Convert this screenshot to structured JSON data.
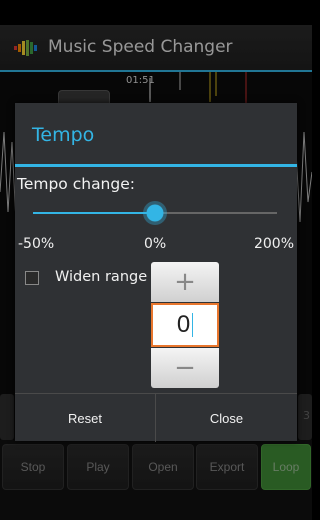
{
  "app": {
    "title": "Music Speed Changer"
  },
  "waveform": {
    "time_label": "01:51",
    "right_side_label": "3"
  },
  "toolbar": {
    "buttons": [
      {
        "label": "Stop"
      },
      {
        "label": "Play"
      },
      {
        "label": "Open"
      },
      {
        "label": "Export"
      },
      {
        "label": "Loop",
        "active": true
      }
    ]
  },
  "dialog": {
    "title": "Tempo",
    "tempo_label": "Tempo change:",
    "slider": {
      "min_label": "-50%",
      "mid_label": "0%",
      "max_label": "200%",
      "value_percent": 0
    },
    "widen_range": {
      "label": "Widen range",
      "checked": false
    },
    "picker": {
      "increment": "+",
      "value": "0",
      "decrement": "−"
    },
    "buttons": {
      "reset": "Reset",
      "close": "Close"
    }
  },
  "colors": {
    "accent": "#33b5e5",
    "loop_active": "#3f8d36",
    "picker_focus": "#e8762d"
  }
}
